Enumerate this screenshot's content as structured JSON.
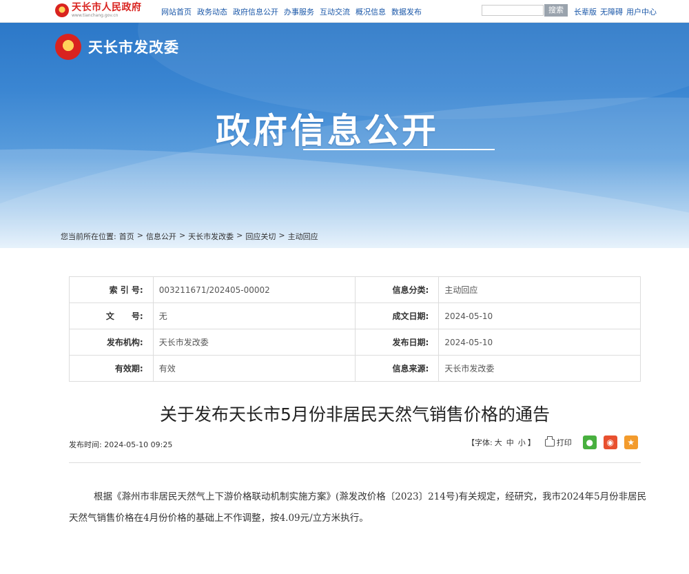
{
  "site": {
    "logo_title": "天长市人民政府",
    "logo_sub": "www.tianchang.gov.cn",
    "nav": [
      "网站首页",
      "政务动态",
      "政府信息公开",
      "办事服务",
      "互动交流",
      "概况信息",
      "数据发布"
    ],
    "search_placeholder": "",
    "search_button": "搜索",
    "right_links": [
      "长辈版",
      "无障碍",
      "用户中心"
    ]
  },
  "banner": {
    "dept_name": "天长市发改委",
    "title": "政府信息公开"
  },
  "breadcrumb": {
    "prefix": "您当前所在位置:",
    "items": [
      "首页",
      "信息公开",
      "天长市发改委",
      "回应关切",
      "主动回应"
    ],
    "separator": ">"
  },
  "info_table": {
    "rows": [
      {
        "l1": "索 引 号:",
        "v1": "003211671/202405-00002",
        "l2": "信息分类:",
        "v2": "主动回应"
      },
      {
        "l1": "文      号:",
        "v1": "无",
        "l2": "成文日期:",
        "v2": "2024-05-10"
      },
      {
        "l1": "发布机构:",
        "v1": "天长市发改委",
        "l2": "发布日期:",
        "v2": "2024-05-10"
      },
      {
        "l1": "有效期:",
        "v1": "有效",
        "l2": "信息来源:",
        "v2": "天长市发改委"
      }
    ]
  },
  "article": {
    "title": "关于发布天长市5月份非居民天然气销售价格的通告",
    "pub_time_label": "发布时间:",
    "pub_time": "2024-05-10 09:25",
    "font_label": "【字体:",
    "font_sizes": [
      "大",
      "中",
      "小"
    ],
    "font_end": "】",
    "print_label": "打印",
    "body": "根据《滁州市非居民天然气上下游价格联动机制实施方案》(滁发改价格〔2023〕214号)有关规定，经研究，我市2024年5月份非居民天然气销售价格在4月份价格的基础上不作调整，按4.09元/立方米执行。"
  },
  "colors": {
    "brand_red": "#d9231f",
    "link_blue": "#1a57a8",
    "banner_blue": "#2c78c8"
  }
}
